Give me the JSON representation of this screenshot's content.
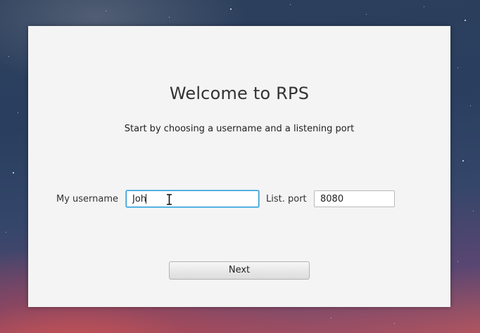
{
  "welcome": {
    "title": "Welcome to RPS",
    "subtitle": "Start by choosing a username and a listening port"
  },
  "form": {
    "username_label": "My username",
    "username_value": "Joh",
    "port_label": "List. port",
    "port_value": "8080"
  },
  "actions": {
    "next_label": "Next"
  },
  "theme": {
    "focus_color": "#2a9bd6",
    "window_bg": "#f4f4f4"
  }
}
